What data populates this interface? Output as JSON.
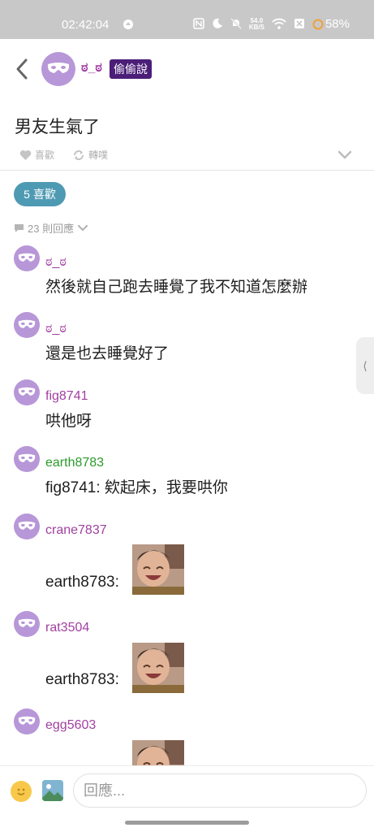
{
  "status_bar": {
    "time": "02:42:04",
    "speed_top": "54.0",
    "speed_bottom": "KB/S",
    "battery": "58%"
  },
  "header": {
    "author": "ಠ_ಠ",
    "tag": "偷偷說",
    "back_icon": "chevron-left-icon",
    "avatar_icon": "mask-icon"
  },
  "post": {
    "title": "男友生氣了",
    "like_label": "喜歡",
    "share_label": "轉噗"
  },
  "likes": {
    "badge": "5 喜歡"
  },
  "replies": {
    "count_label": "23 則回應"
  },
  "comments": [
    {
      "name": "ಠ_ಠ",
      "name_color": "#a13fa0",
      "text": "然後就自己跑去睡覺了我不知道怎麼辦"
    },
    {
      "name": "ಠ_ಠ",
      "name_color": "#a13fa0",
      "text": "還是也去睡覺好了"
    },
    {
      "name": "fig8741",
      "name_color": "#a13fa0",
      "text": "哄他呀"
    },
    {
      "name": "earth8783",
      "name_color": "#2b9a2b",
      "text": "fig8741: 欸起床，我要哄你"
    },
    {
      "name": "crane7837",
      "name_color": "#a13fa0",
      "text": "earth8783:"
    },
    {
      "name": "rat3504",
      "name_color": "#a13fa0",
      "text": "earth8783:"
    },
    {
      "name": "egg5603",
      "name_color": "#a13fa0",
      "text": ""
    }
  ],
  "composer": {
    "placeholder": "回應..."
  },
  "colors": {
    "accent": "#4f9ab3",
    "avatar": "#b797d8",
    "tag_bg": "#4b1e78"
  }
}
